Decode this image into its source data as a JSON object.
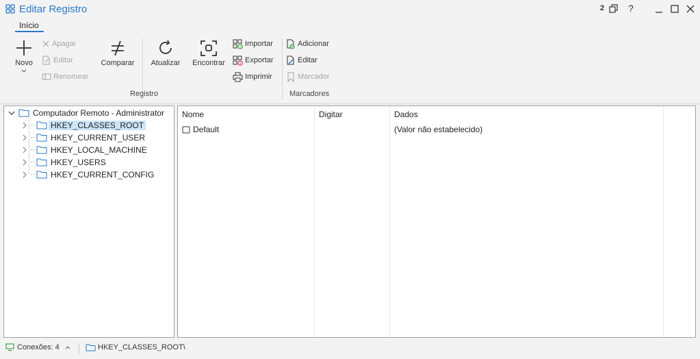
{
  "window": {
    "title": "Editar Registro",
    "connections_badge": "2",
    "help": "?"
  },
  "ribbon": {
    "tab": "Início",
    "buttons": {
      "novo": "Novo",
      "apagar": "Apagar",
      "editar": "Editar",
      "renomear": "Renomear",
      "comparar": "Comparar",
      "atualizar": "Atualizar",
      "encontrar": "Encontrar",
      "importar": "Importar",
      "exportar": "Exportar",
      "imprimir": "Imprimir",
      "adicionar": "Adicionar",
      "editar_marcador": "Editar",
      "marcador": "Marcador"
    },
    "groups": {
      "registro": "Registro",
      "marcadores": "Marcadores"
    }
  },
  "tree": {
    "root": "Computador Remoto - Administrator",
    "items": [
      {
        "label": "HKEY_CLASSES_ROOT",
        "selected": true
      },
      {
        "label": "HKEY_CURRENT_USER"
      },
      {
        "label": "HKEY_LOCAL_MACHINE"
      },
      {
        "label": "HKEY_USERS"
      },
      {
        "label": "HKEY_CURRENT_CONFIG"
      }
    ]
  },
  "list": {
    "columns": [
      "Nome",
      "Digitar",
      "Dados"
    ],
    "rows": [
      {
        "name": "Default",
        "type": "",
        "data": "(Valor não estabelecido)"
      }
    ]
  },
  "status": {
    "connections": "Conexões: 4",
    "path": "HKEY_CLASSES_ROOT\\"
  },
  "colors": {
    "accent": "#2b78c9",
    "selection": "#cce4f7",
    "disabled": "#a6a6a6"
  }
}
